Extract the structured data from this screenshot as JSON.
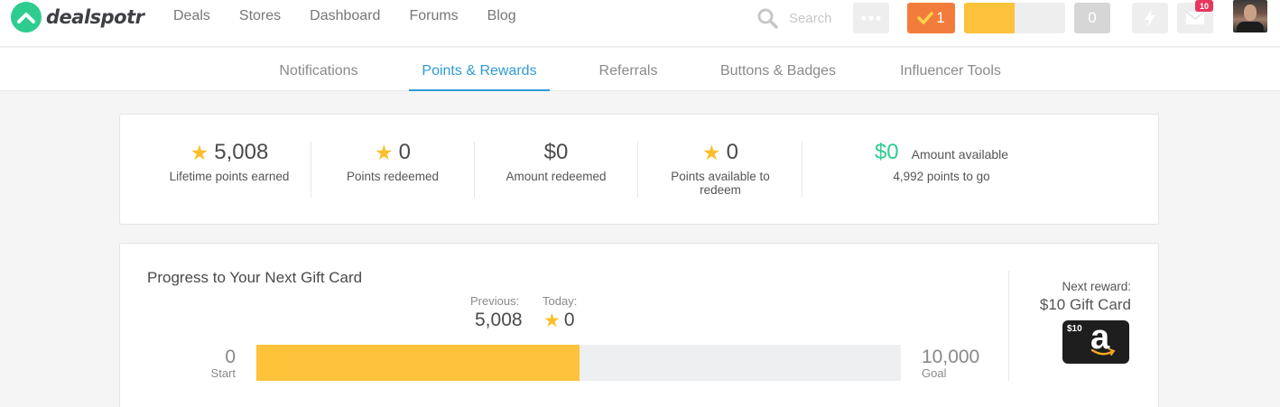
{
  "brand": {
    "name": "dealspotr"
  },
  "nav": [
    "Deals",
    "Stores",
    "Dashboard",
    "Forums",
    "Blog"
  ],
  "search": {
    "placeholder": "Search"
  },
  "toolbar": {
    "check_count": "1",
    "points_progress_percent": 50,
    "zero_count": "0",
    "mail_badge": "10"
  },
  "tabs": [
    "Notifications",
    "Points & Rewards",
    "Referrals",
    "Buttons & Badges",
    "Influencer Tools"
  ],
  "active_tab": "Points & Rewards",
  "stats": {
    "lifetime": {
      "value": "5,008",
      "label": "Lifetime points earned"
    },
    "redeemed": {
      "value": "0",
      "label": "Points redeemed"
    },
    "amount_redeemed": {
      "value": "$0",
      "label": "Amount redeemed"
    },
    "available_points": {
      "value": "0",
      "label": "Points available to redeem"
    },
    "amount_available": {
      "value": "$0",
      "label": "Amount available",
      "sub": "4,992 points to go"
    }
  },
  "progress": {
    "title": "Progress to Your Next Gift Card",
    "previous_label": "Previous:",
    "previous_value": "5,008",
    "today_label": "Today:",
    "today_value": "0",
    "start_value": "0",
    "start_label": "Start",
    "goal_value": "10,000",
    "goal_label": "Goal",
    "fraction": 0.5008,
    "next_reward_label": "Next reward:",
    "next_reward_value": "$10 Gift Card",
    "gift_amount": "$10"
  },
  "colors": {
    "accent_green": "#2ecc8f",
    "accent_blue": "#2e9bd4",
    "progress_yellow": "#fec23b",
    "check_orange": "#f27d3a",
    "badge_pink": "#e8375e"
  }
}
